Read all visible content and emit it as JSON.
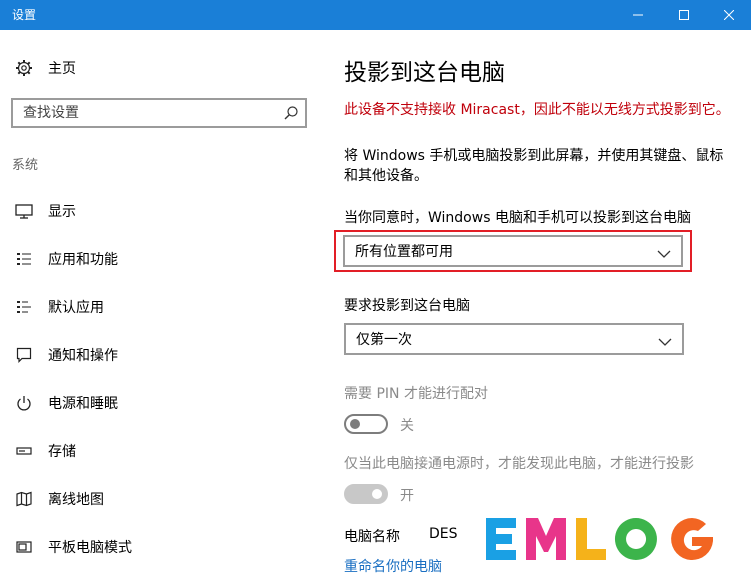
{
  "window": {
    "title": "设置",
    "minimize_icon": "minimize-icon",
    "maximize_icon": "maximize-icon",
    "close_icon": "close-icon"
  },
  "sidebar": {
    "home_label": "主页",
    "home_icon": "gear-icon",
    "search_placeholder": "查找设置",
    "search_icon": "search-icon",
    "section_label": "系统",
    "items": [
      {
        "label": "显示",
        "icon": "display-icon"
      },
      {
        "label": "应用和功能",
        "icon": "apps-list-icon"
      },
      {
        "label": "默认应用",
        "icon": "default-apps-icon"
      },
      {
        "label": "通知和操作",
        "icon": "notification-icon"
      },
      {
        "label": "电源和睡眠",
        "icon": "power-icon"
      },
      {
        "label": "存储",
        "icon": "storage-icon"
      },
      {
        "label": "离线地图",
        "icon": "map-icon"
      },
      {
        "label": "平板电脑模式",
        "icon": "tablet-icon"
      }
    ]
  },
  "main": {
    "title": "投影到这台电脑",
    "warning": "此设备不支持接收 Miracast，因此不能以无线方式投影到它。",
    "description": "将 Windows 手机或电脑投影到此屏幕，并使用其键盘、鼠标和其他设备。",
    "availability_label": "当你同意时，Windows 电脑和手机可以投影到这台电脑",
    "availability_value": "所有位置都可用",
    "ask_label": "要求投影到这台电脑",
    "ask_value": "仅第一次",
    "pin_label": "需要 PIN 才能进行配对",
    "pin_state": "关",
    "power_label": "仅当此电脑接通电源时，才能发现此电脑，才能进行投影",
    "power_state": "开",
    "pc_name_label": "电脑名称",
    "pc_name_value": "DES",
    "rename_link": "重命名你的电脑"
  },
  "watermark": {
    "text": "EMLOG",
    "colors": [
      "#1aa0e4",
      "#e8358a",
      "#f5b21a",
      "#3cb44b",
      "#f26522"
    ]
  },
  "colors": {
    "titlebar": "#1a7fd7",
    "warning": "#c0000b",
    "highlight_border": "#e21e26",
    "link": "#1a6fc2"
  }
}
